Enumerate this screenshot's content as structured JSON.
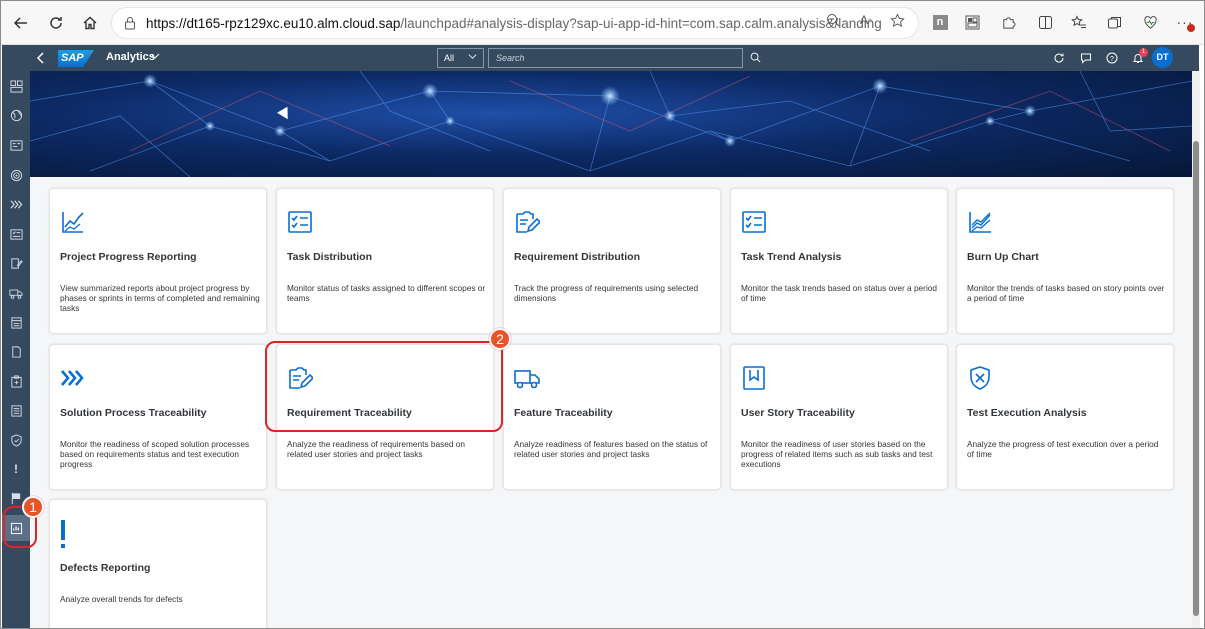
{
  "browser": {
    "url_host": "https://dt165-rpz129xc.eu10.alm.cloud.sap",
    "url_rest": "/launchpad#analysis-display?sap-ui-app-id-hint=com.sap.calm.analysis&/landing"
  },
  "shell": {
    "title": "Analytics",
    "scope_label": "All",
    "search_placeholder": "Search",
    "notification_count": "1",
    "avatar_initials": "DT"
  },
  "tiles": [
    {
      "title": "Project Progress Reporting",
      "description": "View summarized reports about project progress by phases or sprints in terms of completed and remaining tasks",
      "icon": "line-chart-icon"
    },
    {
      "title": "Task Distribution",
      "description": "Monitor status of tasks assigned to different scopes or teams",
      "icon": "task-list-icon"
    },
    {
      "title": "Requirement Distribution",
      "description": "Track the progress of requirements using selected dimensions",
      "icon": "document-edit-icon"
    },
    {
      "title": "Task Trend Analysis",
      "description": "Monitor the task trends based on status over a period of time",
      "icon": "task-list-icon"
    },
    {
      "title": "Burn Up Chart",
      "description": "Monitor the trends of tasks based on story points over a period of time",
      "icon": "burn-up-chart-icon"
    },
    {
      "title": "Solution Process Traceability",
      "description": "Monitor the readiness of scoped solution processes based on requirements status and test execution progress",
      "icon": "process-chevrons-icon"
    },
    {
      "title": "Requirement Traceability",
      "description": "Analyze the readiness of requirements based on related user stories and project tasks",
      "icon": "document-edit-icon"
    },
    {
      "title": "Feature Traceability",
      "description": "Analyze readiness of features based on the status of related user stories and project tasks",
      "icon": "truck-icon"
    },
    {
      "title": "User Story Traceability",
      "description": "Monitor the readiness of user stories based on the progress of related items such as sub tasks and test executions",
      "icon": "bookmark-icon"
    },
    {
      "title": "Test Execution Analysis",
      "description": "Analyze the progress of test execution over a period of time",
      "icon": "shield-x-icon"
    },
    {
      "title": "Defects Reporting",
      "description": "Analyze overall trends for defects",
      "icon": "exclamation-icon"
    }
  ],
  "callouts": {
    "step1": "1",
    "step2": "2"
  },
  "colors": {
    "shell": "#354a5f",
    "accent": "#0a6ed1",
    "callout": "#e8542a",
    "highlight": "#d9262b"
  }
}
